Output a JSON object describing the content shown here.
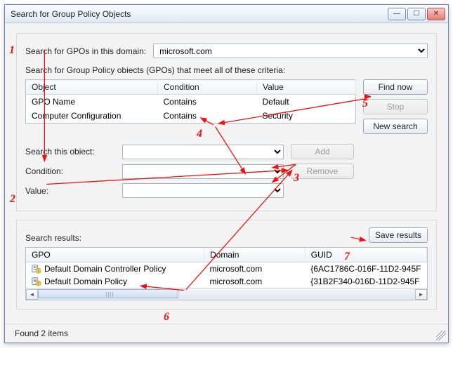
{
  "window": {
    "title": "Search for Group Policy Objects"
  },
  "domain_row": {
    "label": "Search for GPOs in this domain:",
    "value": "microsoft.com"
  },
  "criteria": {
    "caption": "Search for Group Policy obiects (GPOs) that meet all of these criteria:",
    "headers": {
      "object": "Object",
      "condition": "Condition",
      "value": "Value"
    },
    "rows": [
      {
        "object": "GPO Name",
        "condition": "Contains",
        "value": "Default"
      },
      {
        "object": "Computer Configuration",
        "condition": "Contains",
        "value": "Security"
      }
    ]
  },
  "buttons": {
    "find_now": "Find now",
    "stop": "Stop",
    "new_search": "New search",
    "add": "Add",
    "remove": "Remove",
    "save_results": "Save results"
  },
  "fields": {
    "object_label": "Search this obiect:",
    "condition_label": "Condition:",
    "value_label": "Value:",
    "object_value": "",
    "condition_value": "",
    "value_value": ""
  },
  "results": {
    "label": "Search results:",
    "headers": {
      "gpo": "GPO",
      "domain": "Domain",
      "guid": "GUID"
    },
    "rows": [
      {
        "gpo": "Default Domain Controller Policy",
        "domain": "microsoft.com",
        "guid": "{6AC1786C-016F-11D2-945F"
      },
      {
        "gpo": "Default Domain Policy",
        "domain": "microsoft.com",
        "guid": "{31B2F340-016D-11D2-945F"
      }
    ]
  },
  "status": "Found 2 items",
  "annotations": [
    "1",
    "2",
    "3",
    "4",
    "5",
    "6",
    "7"
  ]
}
